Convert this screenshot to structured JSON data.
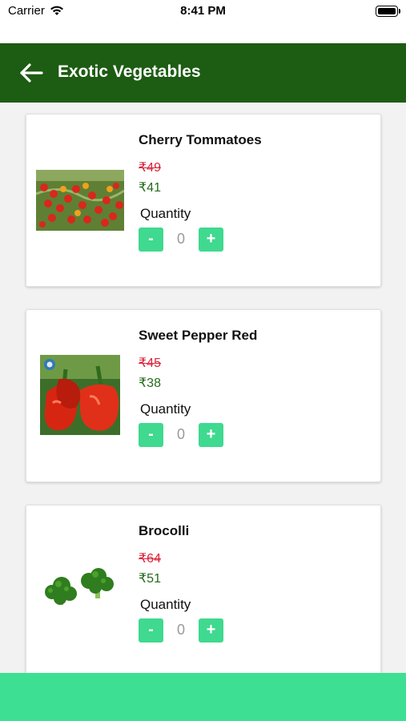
{
  "status_bar": {
    "carrier": "Carrier",
    "time": "8:41 PM",
    "wifi_icon": "wifi-icon",
    "battery_icon": "battery-icon"
  },
  "header": {
    "title": "Exotic Vegetables",
    "back_icon": "arrow-left-icon",
    "background": "#1d5c13"
  },
  "colors": {
    "accent": "#3ddf92",
    "mrp": "#d8243a",
    "price": "#246b1a"
  },
  "products": [
    {
      "name": "Cherry Tommatoes",
      "mrp": "₹49",
      "price": "₹41",
      "quantity_label": "Quantity",
      "quantity": "0",
      "minus": "-",
      "plus": "+"
    },
    {
      "name": "Sweet Pepper Red",
      "mrp": "₹45",
      "price": "₹38",
      "quantity_label": "Quantity",
      "quantity": "0",
      "minus": "-",
      "plus": "+"
    },
    {
      "name": "Brocolli",
      "mrp": "₹64",
      "price": "₹51",
      "quantity_label": "Quantity",
      "quantity": "0",
      "minus": "-",
      "plus": "+"
    }
  ]
}
